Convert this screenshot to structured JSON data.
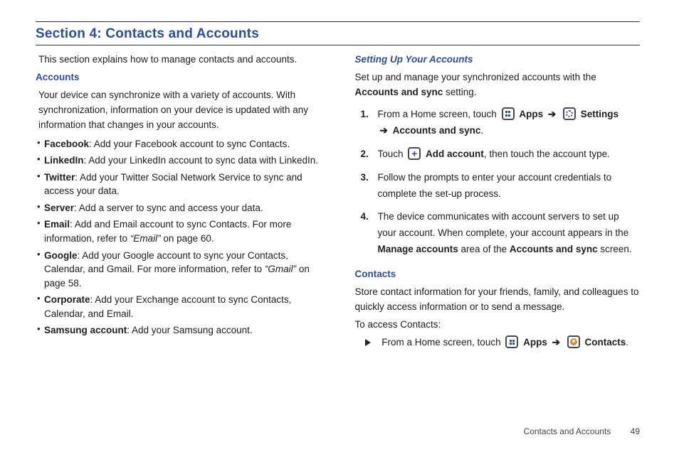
{
  "section_title": "Section 4: Contacts and Accounts",
  "left": {
    "intro": "This section explains how to manage contacts and accounts.",
    "accounts": {
      "heading": "Accounts",
      "body": "Your device can synchronize with a variety of accounts. With synchronization, information on your device is updated with any information that changes in your accounts.",
      "items": {
        "facebook_label": "Facebook",
        "facebook_text": ": Add your Facebook account to sync Contacts.",
        "linkedin_label": "LinkedIn",
        "linkedin_text": ": Add your LinkedIn account to sync data with LinkedIn.",
        "twitter_label": "Twitter",
        "twitter_text": ": Add your Twitter Social Network Service to sync and access your data.",
        "server_label": "Server",
        "server_text": ": Add a server to sync and access your data.",
        "email_label": "Email",
        "email_text_a": ": Add and Email account to sync Contacts. For more information, refer to ",
        "email_ref": "“Email” ",
        "email_text_b": " on page 60.",
        "google_label": "Google",
        "google_text_a": ": Add your Google account to sync your Contacts, Calendar, and Gmail. For more information, refer to ",
        "google_ref": "“Gmail” ",
        "google_text_b": " on page 58.",
        "corporate_label": "Corporate",
        "corporate_text": ": Add your Exchange account to sync Contacts, Calendar, and Email.",
        "samsung_label": "Samsung account",
        "samsung_text": ": Add your Samsung account."
      }
    }
  },
  "right": {
    "setup": {
      "heading": "Setting Up Your Accounts",
      "body_a": "Set up and manage your synchronized accounts with the ",
      "body_b_bold": "Accounts and sync",
      "body_c": " setting.",
      "step1_a": "From a Home screen, touch ",
      "step1_apps": "Apps",
      "step1_settings": "Settings",
      "step1_line2_bold": "Accounts and sync",
      "step2_a": "Touch ",
      "step2_add": "Add account",
      "step2_b": ", then touch the account type.",
      "step3": "Follow the prompts to enter your account credentials to complete the set-up process.",
      "step4_a": "The device communicates with account servers to set up your account. When complete, your account appears in the ",
      "step4_bold1": "Manage accounts",
      "step4_mid": " area of the ",
      "step4_bold2": "Accounts and sync",
      "step4_end": " screen.",
      "arrow": "➔"
    },
    "contacts": {
      "heading": "Contacts",
      "body": "Store contact information for your friends, family, and colleagues to quickly access information or to send a message.",
      "access_label": "To access Contacts:",
      "line_a": "From a Home screen, touch ",
      "apps": "Apps",
      "contacts_word": "Contacts",
      "period": "."
    }
  },
  "footer": {
    "label": "Contacts and Accounts",
    "page": "49"
  }
}
